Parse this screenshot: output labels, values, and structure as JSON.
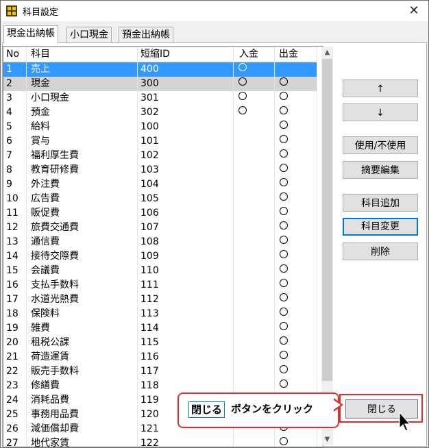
{
  "window": {
    "title": "科目設定",
    "close_glyph": "✕"
  },
  "tabs": [
    {
      "label": "現金出納帳",
      "active": true
    },
    {
      "label": "小口現金",
      "active": false
    },
    {
      "label": "預金出納帳",
      "active": false
    }
  ],
  "table": {
    "headers": [
      "No",
      "科目",
      "短縮ID",
      "入金",
      "出金"
    ],
    "rows": [
      {
        "no": "1",
        "name": "売上",
        "id": "400",
        "in": true,
        "out": false,
        "state": "selected"
      },
      {
        "no": "2",
        "name": "現金",
        "id": "300",
        "in": true,
        "out": true,
        "state": "gray"
      },
      {
        "no": "3",
        "name": "小口現金",
        "id": "301",
        "in": true,
        "out": true,
        "state": ""
      },
      {
        "no": "4",
        "name": "預金",
        "id": "302",
        "in": true,
        "out": true,
        "state": ""
      },
      {
        "no": "5",
        "name": "給料",
        "id": "100",
        "in": false,
        "out": true,
        "state": ""
      },
      {
        "no": "6",
        "name": "賞与",
        "id": "101",
        "in": false,
        "out": true,
        "state": ""
      },
      {
        "no": "7",
        "name": "福利厚生費",
        "id": "102",
        "in": false,
        "out": true,
        "state": ""
      },
      {
        "no": "8",
        "name": "教育研修費",
        "id": "103",
        "in": false,
        "out": true,
        "state": ""
      },
      {
        "no": "9",
        "name": "外注費",
        "id": "104",
        "in": false,
        "out": true,
        "state": ""
      },
      {
        "no": "10",
        "name": "広告費",
        "id": "105",
        "in": false,
        "out": true,
        "state": ""
      },
      {
        "no": "11",
        "name": "販促費",
        "id": "106",
        "in": false,
        "out": true,
        "state": ""
      },
      {
        "no": "12",
        "name": "旅費交通費",
        "id": "107",
        "in": false,
        "out": true,
        "state": ""
      },
      {
        "no": "13",
        "name": "通信費",
        "id": "108",
        "in": false,
        "out": true,
        "state": ""
      },
      {
        "no": "14",
        "name": "接待交際費",
        "id": "109",
        "in": false,
        "out": true,
        "state": ""
      },
      {
        "no": "15",
        "name": "会議費",
        "id": "110",
        "in": false,
        "out": true,
        "state": ""
      },
      {
        "no": "16",
        "name": "支払手数料",
        "id": "111",
        "in": false,
        "out": true,
        "state": ""
      },
      {
        "no": "17",
        "name": "水道光熱費",
        "id": "112",
        "in": false,
        "out": true,
        "state": ""
      },
      {
        "no": "18",
        "name": "保険料",
        "id": "113",
        "in": false,
        "out": true,
        "state": ""
      },
      {
        "no": "19",
        "name": "雑費",
        "id": "114",
        "in": false,
        "out": true,
        "state": ""
      },
      {
        "no": "20",
        "name": "租税公課",
        "id": "115",
        "in": false,
        "out": true,
        "state": ""
      },
      {
        "no": "21",
        "name": "荷造運賃",
        "id": "116",
        "in": false,
        "out": true,
        "state": ""
      },
      {
        "no": "22",
        "name": "販売手数料",
        "id": "117",
        "in": false,
        "out": true,
        "state": ""
      },
      {
        "no": "23",
        "name": "修繕費",
        "id": "118",
        "in": false,
        "out": true,
        "state": ""
      },
      {
        "no": "24",
        "name": "消耗品費",
        "id": "119",
        "in": false,
        "out": true,
        "state": ""
      },
      {
        "no": "25",
        "name": "事務用品費",
        "id": "120",
        "in": false,
        "out": true,
        "state": ""
      },
      {
        "no": "26",
        "name": "減価償却費",
        "id": "121",
        "in": false,
        "out": true,
        "state": ""
      },
      {
        "no": "27",
        "name": "地代家賃",
        "id": "122",
        "in": false,
        "out": true,
        "state": ""
      }
    ]
  },
  "buttons": {
    "up": "↑",
    "down": "↓",
    "toggle_use": "使用/不使用",
    "edit_summary": "摘要編集",
    "add": "科目追加",
    "change": "科目変更",
    "delete": "削除",
    "close": "閉じる"
  },
  "callout": {
    "key": "閉じる",
    "text": "ボタンをクリック",
    "color": "#e32d2d"
  },
  "colors": {
    "selection": "#3399ff",
    "highlight_row": "#d4d4d4",
    "focus_border": "#0078d7"
  }
}
